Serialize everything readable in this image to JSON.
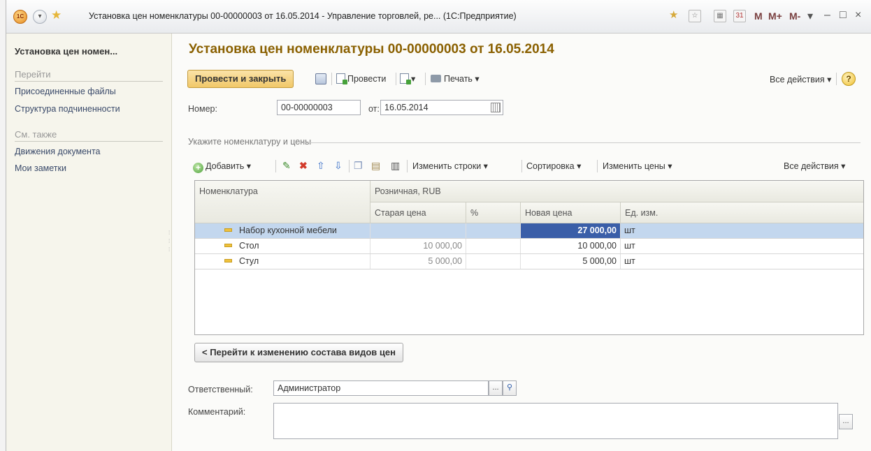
{
  "titlebar": {
    "logo": "1С",
    "title": "Установка цен номенклатуры 00-00000003 от 16.05.2014 - Управление торговлей, ре... (1С:Предприятие)",
    "m": "M",
    "mplus": "M+",
    "mminus": "M-",
    "minimize": "–",
    "maximize": "□",
    "close": "×"
  },
  "sidebar": {
    "header": "Установка цен номен...",
    "goto_title": "Перейти",
    "goto_items": [
      "Присоединенные файлы",
      "Структура подчиненности"
    ],
    "see_also_title": "См. также",
    "see_also_items": [
      "Движения документа",
      "Мои заметки"
    ]
  },
  "form": {
    "title": "Установка цен номенклатуры 00-00000003 от 16.05.2014",
    "toolbar": {
      "post_close": "Провести и закрыть",
      "post": "Провести",
      "print": "Печать ▾",
      "all_actions": "Все действия ▾",
      "help": "?"
    },
    "number_label": "Номер:",
    "number_value": "00-00000003",
    "date_label": "от:",
    "date_value": "16.05.2014",
    "group_title": "Укажите номенклатуру и цены",
    "table_toolbar": {
      "add": "Добавить ▾",
      "change_rows": "Изменить строки ▾",
      "sort": "Сортировка ▾",
      "change_prices": "Изменить цены ▾",
      "all_actions": "Все действия ▾"
    },
    "table": {
      "col_item": "Номенклатура",
      "price_group": "Розничная, RUB",
      "col_old": "Старая цена",
      "col_pct": "%",
      "col_new": "Новая цена",
      "col_unit": "Ед. изм.",
      "rows": [
        {
          "item": "Набор кухонной мебели",
          "old": "",
          "pct": "",
          "new": "27 000,00",
          "unit": "шт"
        },
        {
          "item": "Стол",
          "old": "10 000,00",
          "pct": "",
          "new": "10 000,00",
          "unit": "шт"
        },
        {
          "item": "Стул",
          "old": "5 000,00",
          "pct": "",
          "new": "5 000,00",
          "unit": "шт"
        }
      ]
    },
    "back_button": "< Перейти к изменению состава видов цен",
    "responsible_label": "Ответственный:",
    "responsible_value": "Администратор",
    "comment_label": "Комментарий:",
    "comment_value": "",
    "dots": "..."
  },
  "colors": {
    "accent_title": "#8a6000",
    "primary_button": "#f1c868",
    "selected_row": "#c3d7ee",
    "active_cell": "#3a5ea8"
  }
}
